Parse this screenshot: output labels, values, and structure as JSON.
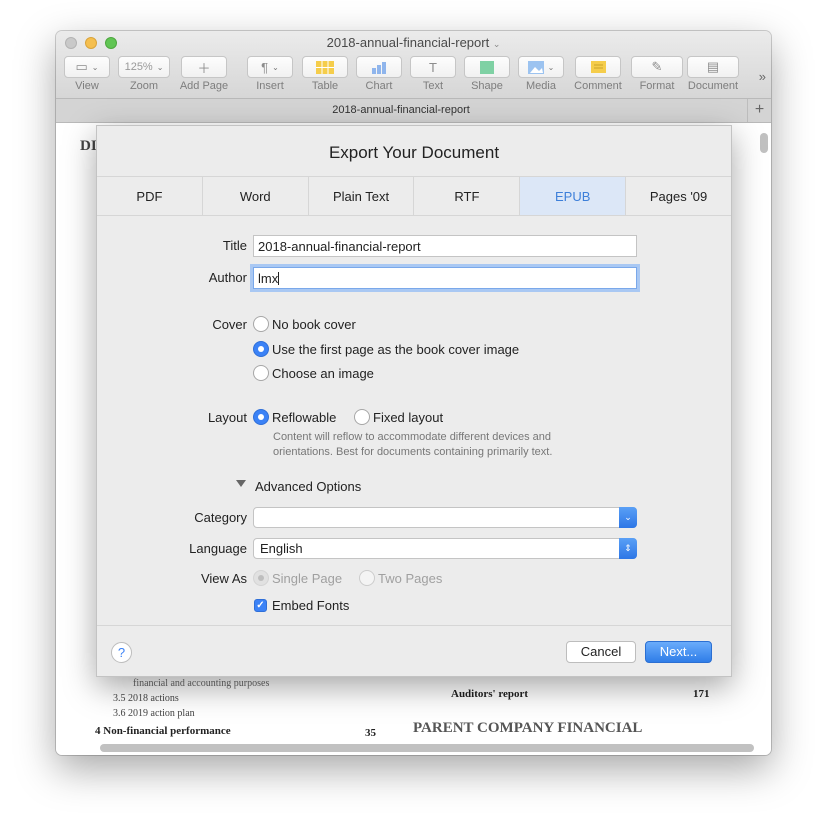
{
  "window": {
    "title": "2018-annual-financial-report",
    "tab_title": "2018-annual-financial-report"
  },
  "toolbar": {
    "items": [
      {
        "label": "View",
        "icon": "sidebar-icon"
      },
      {
        "label": "Zoom",
        "value": "125%"
      },
      {
        "label": "Add Page",
        "icon": "plus-icon"
      },
      {
        "label": "Insert",
        "icon": "pilcrow-icon"
      },
      {
        "label": "Table",
        "icon": "table-icon"
      },
      {
        "label": "Chart",
        "icon": "chart-icon"
      },
      {
        "label": "Text",
        "icon": "text-icon"
      },
      {
        "label": "Shape",
        "icon": "shape-icon"
      },
      {
        "label": "Media",
        "icon": "media-icon"
      },
      {
        "label": "Comment",
        "icon": "comment-icon"
      },
      {
        "label": "Format",
        "icon": "brush-icon"
      },
      {
        "label": "Document",
        "icon": "document-icon"
      }
    ],
    "more": "»"
  },
  "document": {
    "heading_fragment": "DI",
    "line_1": "financial and accounting purposes",
    "line_2": "3.5 2018 actions",
    "line_3": "3.6 2019 action plan",
    "line_4": "4 Non-financial performance",
    "line_4_page": "35",
    "right_1": "Auditors' report",
    "right_1_page": "171",
    "right_2": "PARENT COMPANY FINANCIAL"
  },
  "dialog": {
    "title": "Export Your Document",
    "tabs": [
      "PDF",
      "Word",
      "Plain Text",
      "RTF",
      "EPUB",
      "Pages '09"
    ],
    "active_tab": "EPUB",
    "title_label": "Title",
    "title_value": "2018-annual-financial-report",
    "author_label": "Author",
    "author_value": "lmx",
    "cover_label": "Cover",
    "cover_options": [
      "No book cover",
      "Use the first page as the book cover image",
      "Choose an image"
    ],
    "cover_selected": 1,
    "layout_label": "Layout",
    "layout_options": [
      "Reflowable",
      "Fixed layout"
    ],
    "layout_selected": 0,
    "layout_note": "Content will reflow to accommodate different devices and orientations. Best for documents containing primarily text.",
    "advanced_label": "Advanced Options",
    "category_label": "Category",
    "category_value": "",
    "language_label": "Language",
    "language_value": "English",
    "view_as_label": "View As",
    "view_as_options": [
      "Single Page",
      "Two Pages"
    ],
    "embed_fonts_label": "Embed Fonts",
    "embed_fonts_checked": true,
    "help": "?",
    "cancel_label": "Cancel",
    "next_label": "Next..."
  },
  "colors": {
    "accent": "#3b82f6",
    "active_tab_bg": "#dce7f7"
  }
}
